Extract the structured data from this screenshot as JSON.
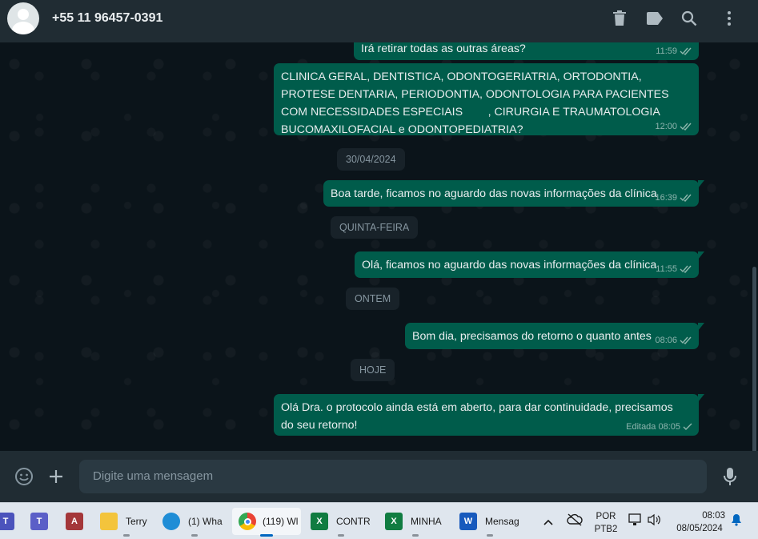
{
  "header": {
    "contact_name": "+55 11 96457-0391",
    "icons": [
      "delete-icon",
      "label-icon",
      "search-icon",
      "menu-icon"
    ]
  },
  "messages": [
    {
      "text": "Irá retirar todas as outras áreas?",
      "time": "11:59",
      "status": "read"
    },
    {
      "text": "CLINICA GERAL, DENTISTICA, ODONTOGERIATRIA, ORTODONTIA, PROTESE DENTARIA, PERIODONTIA, ODONTOLOGIA PARA PACIENTES COM NECESSIDADES ESPECIAIS        , CIRURGIA E TRAUMATOLOGIA BUCOMAXILOFACIAL e ODONTOPEDIATRIA?",
      "time": "12:00",
      "status": "read"
    },
    {
      "text": "Boa tarde, ficamos no aguardo das novas informações da clínica",
      "time": "16:39",
      "status": "read"
    },
    {
      "text": "Olá, ficamos no aguardo das novas informações da clínica",
      "time": "11:55",
      "status": "read"
    },
    {
      "text": "Bom dia, precisamos do retorno o quanto antes",
      "time": "08:06",
      "status": "read"
    },
    {
      "text": "Olá Dra. o protocolo ainda está em aberto, para dar continuidade, precisamos do seu retorno!",
      "time": "Editada 08:05",
      "status": "sent"
    }
  ],
  "dates": {
    "d1": "30/04/2024",
    "d2": "QUINTA-FEIRA",
    "d3": "ONTEM",
    "d4": "HOJE"
  },
  "composer": {
    "placeholder": "Digite uma mensagem"
  },
  "taskbar": {
    "items": [
      {
        "label": ""
      },
      {
        "label": ""
      },
      {
        "label": ""
      },
      {
        "label": "Terry"
      },
      {
        "label": "(1) Wha"
      },
      {
        "label": "(119) Wl"
      },
      {
        "label": "CONTR"
      },
      {
        "label": "MINHA"
      },
      {
        "label": "Mensag"
      }
    ],
    "lang_line1": "POR",
    "lang_line2": "PTB2",
    "clock_time": "08:03",
    "clock_date": "08/05/2024"
  },
  "colors": {
    "outgoing_bubble": "#005c4b",
    "chat_bg": "#0b141a",
    "header_bg": "#202c33",
    "read_tick": "#53bdeb"
  }
}
